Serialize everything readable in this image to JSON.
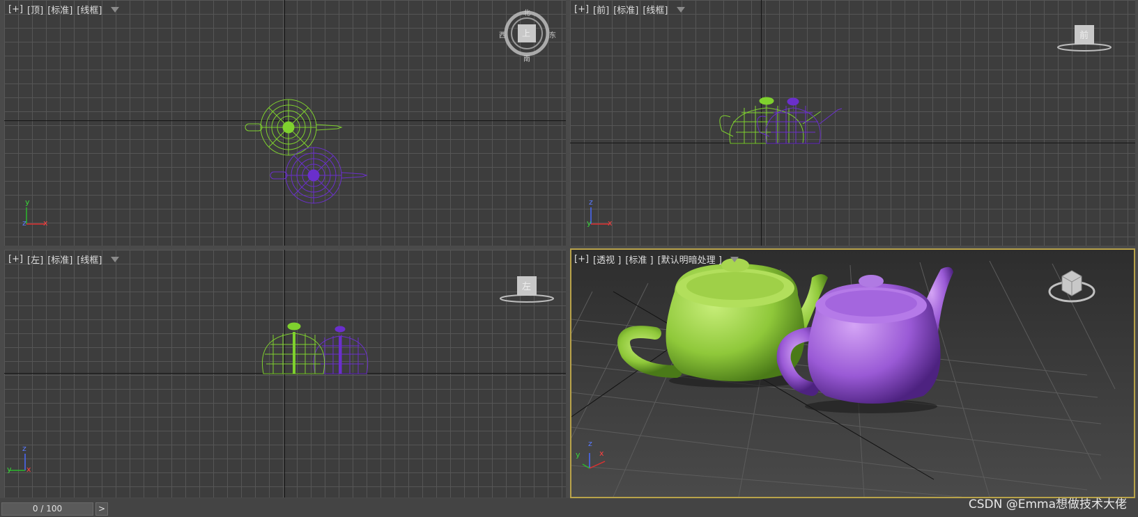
{
  "viewports": {
    "top": {
      "plus": "[+]",
      "view": "[顶]",
      "quality": "[标准]",
      "shading": "[线框]",
      "compass": {
        "n": "北",
        "s": "南",
        "e": "东",
        "w": "西",
        "face": "上"
      },
      "axes": {
        "a": "y",
        "b": "x",
        "c": "z"
      }
    },
    "front": {
      "plus": "[+]",
      "view": "[前]",
      "quality": "[标准]",
      "shading": "[线框]",
      "cube_face": "前",
      "axes": {
        "a": "z",
        "b": "x",
        "c": "y"
      }
    },
    "left": {
      "plus": "[+]",
      "view": "[左]",
      "quality": "[标准]",
      "shading": "[线框]",
      "cube_face": "左",
      "axes": {
        "a": "z",
        "b": "y",
        "c": "x"
      }
    },
    "perspective": {
      "plus": "[+]",
      "view": "[透视 ]",
      "quality": "[标准 ]",
      "shading": "[默认明暗处理 ]",
      "axes": {
        "a": "z",
        "b": "x",
        "c": "y"
      }
    }
  },
  "timeline": {
    "frame": "0 / 100",
    "next_icon": "next-frame-icon",
    "next_glyph": ">"
  },
  "watermark": "CSDN @Emma想做技术大佬",
  "colors": {
    "green": "#7fd12e",
    "purple": "#6a2fcc",
    "green_solid": "#9ccc4a",
    "purple_solid": "#9a5ad6",
    "active_border": "#b9a34a"
  },
  "objects": [
    {
      "name": "teapot-green",
      "color": "green"
    },
    {
      "name": "teapot-purple",
      "color": "purple"
    }
  ]
}
